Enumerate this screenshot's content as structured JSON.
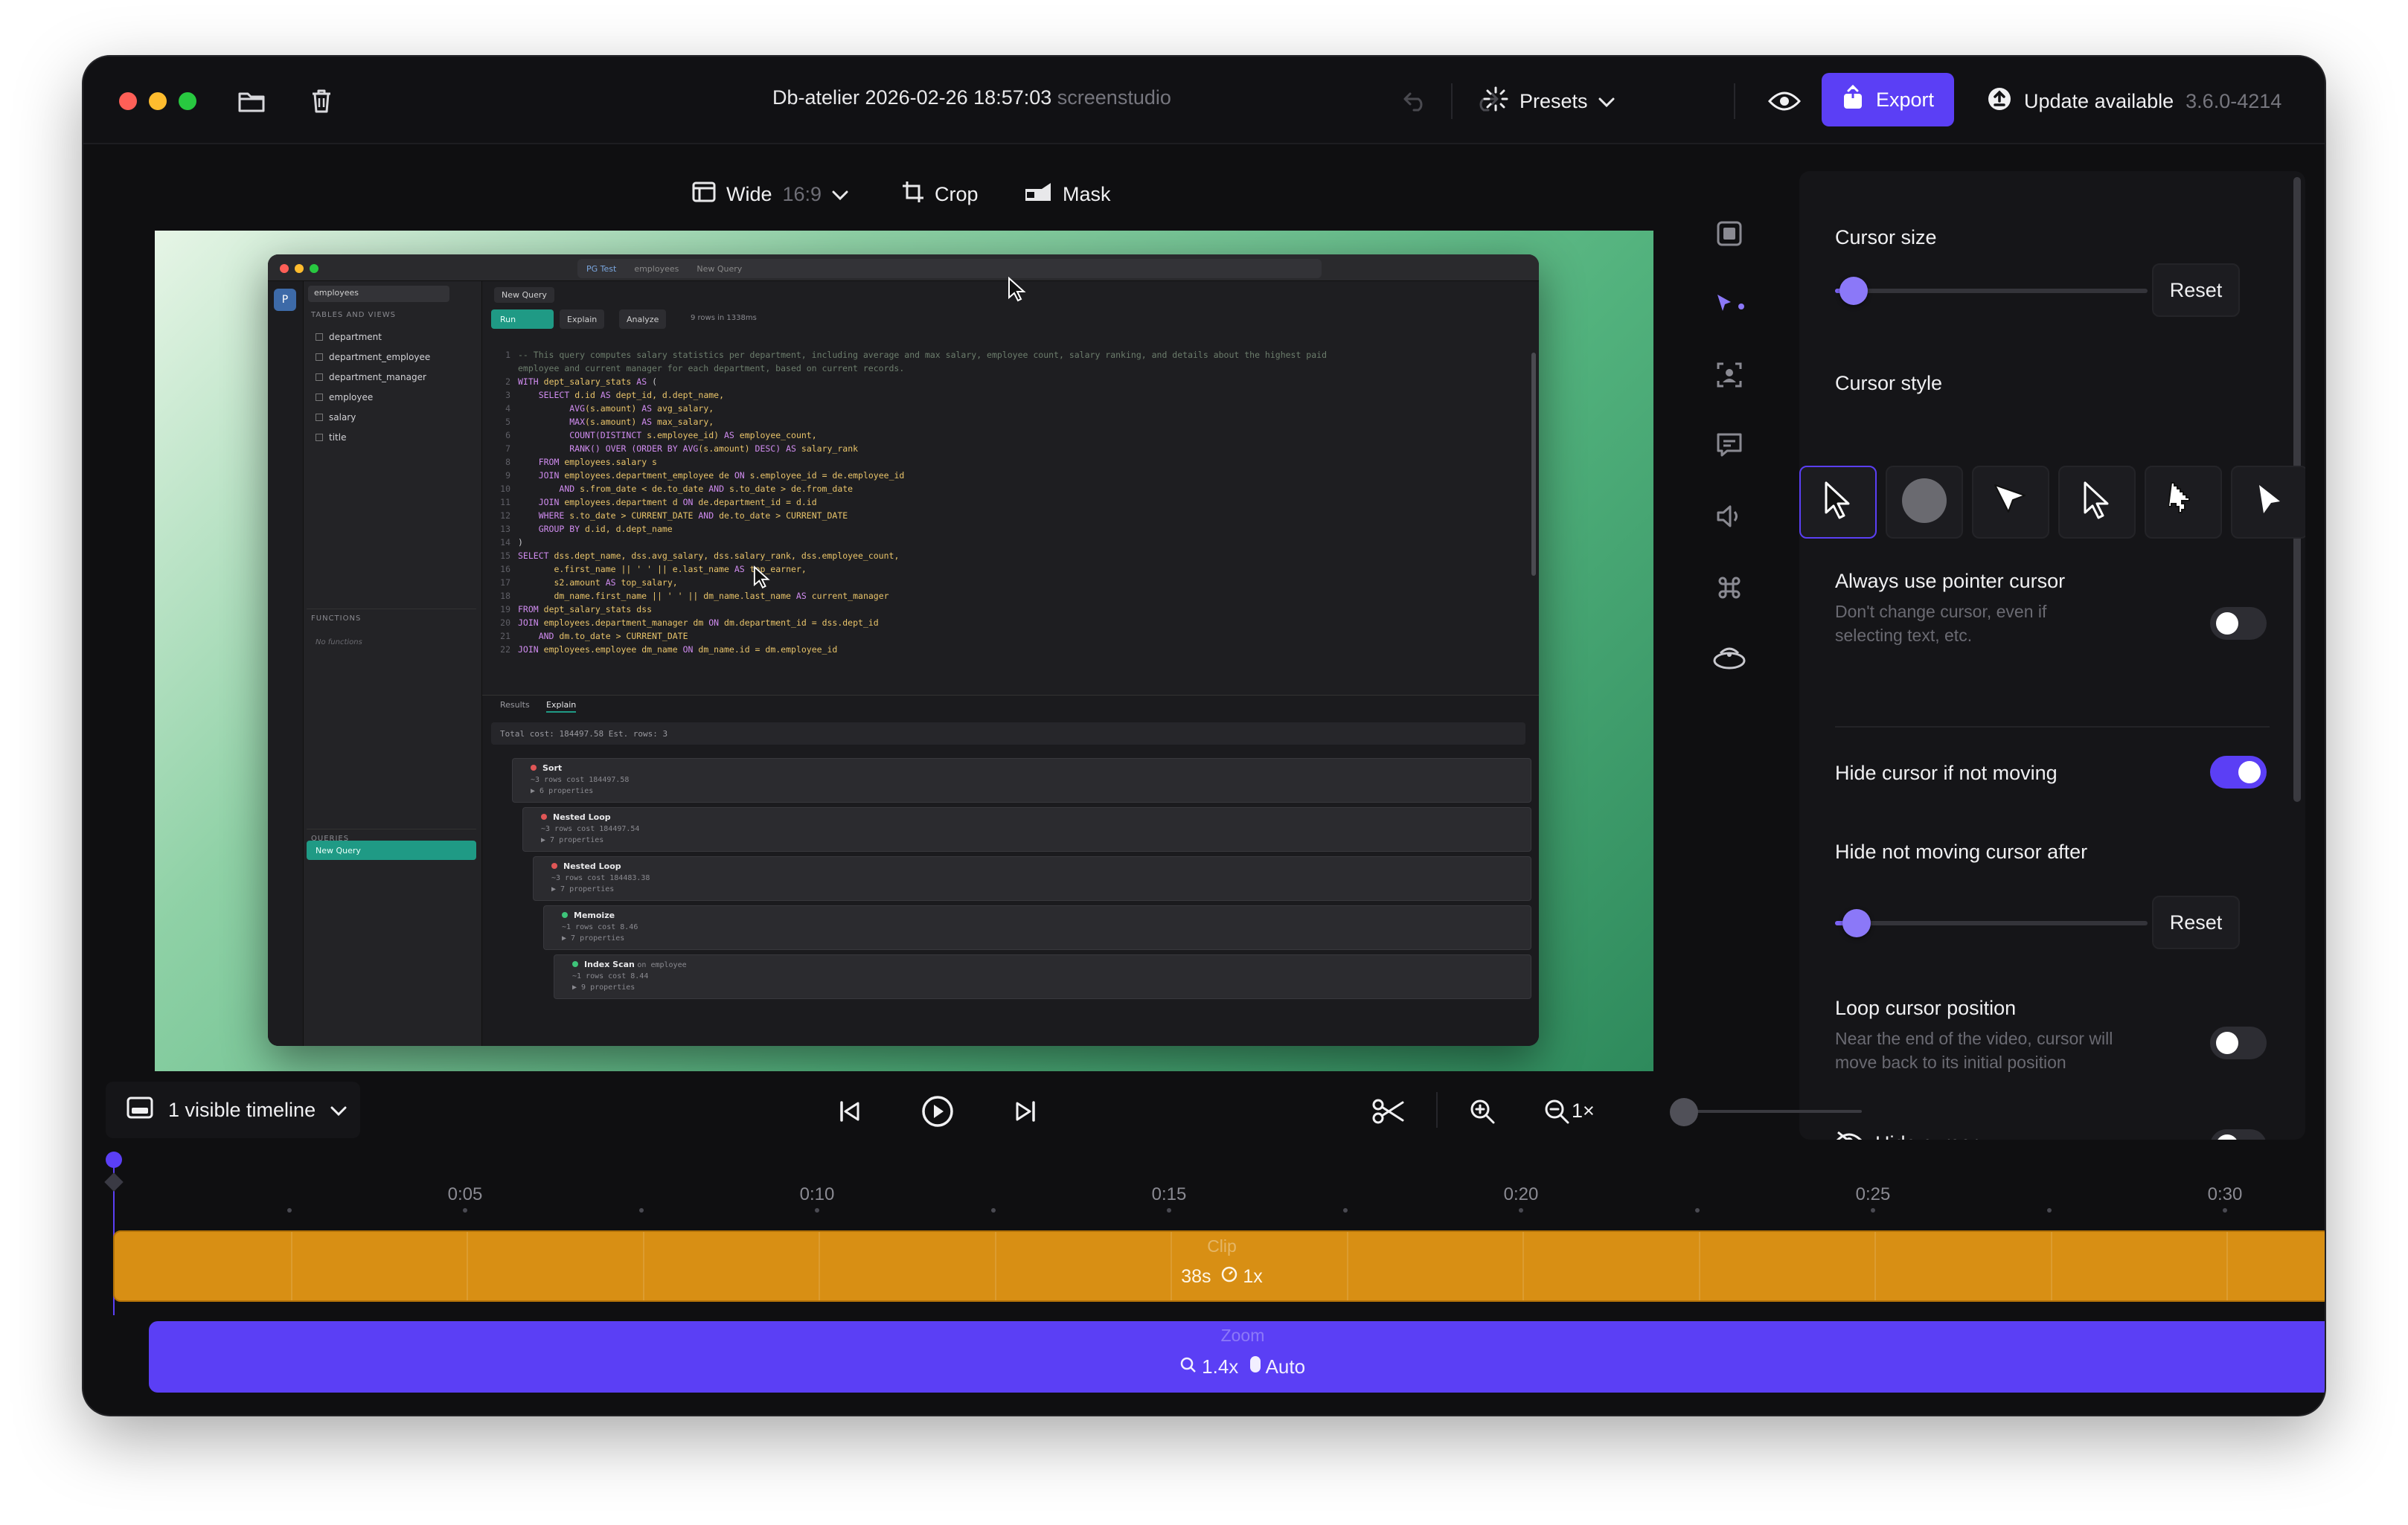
{
  "window": {
    "title": "Db-atelier 2026-02-26 18:57:03",
    "title_suffix": "screenstudio",
    "presets_label": "Presets",
    "export_label": "Export",
    "update_label": "Update available",
    "update_version": "3.6.0-4214"
  },
  "canvas_toolbar": {
    "aspect_label": "Wide",
    "aspect_ratio": "16:9",
    "crop_label": "Crop",
    "mask_label": "Mask"
  },
  "recording": {
    "tab_connection": "PG Test",
    "tab_schema": "employees",
    "tab_query": "New Query",
    "schema_select": "employees",
    "tables_header": "TABLES AND VIEWS",
    "tables": [
      "department",
      "department_employee",
      "department_manager",
      "employee",
      "salary",
      "title"
    ],
    "functions_header": "FUNCTIONS",
    "no_functions": "No functions",
    "queries_header": "QUERIES",
    "query_item": "New Query",
    "editor_tab": "New Query",
    "run_label": "Run",
    "explain_label": "Explain",
    "analyze_label": "Analyze",
    "rows_info": "9 rows in 1338ms",
    "results_tab": "Results",
    "explain_tab": "Explain",
    "total_cost": "Total cost: 184497.58  Est. rows: 3",
    "plan_nodes": [
      {
        "name": "Sort",
        "detail": "~3 rows  cost 184497.58",
        "props": "▶ 6 properties"
      },
      {
        "name": "Nested Loop",
        "detail": "~3 rows  cost 184497.54",
        "props": "▶ 7 properties"
      },
      {
        "name": "Nested Loop",
        "detail": "~3 rows  cost 184483.38",
        "props": "▶ 7 properties"
      },
      {
        "name": "Memoize",
        "detail": "~1 rows  cost 8.46",
        "props": "▶ 7 properties"
      },
      {
        "name": "Index Scan",
        "detail": "~1 rows  cost 8.44",
        "props": "▶ 9 properties",
        "suffix": "on employee"
      }
    ]
  },
  "settings": {
    "cursor_size_label": "Cursor size",
    "cursor_size_value": 0.06,
    "reset_label": "Reset",
    "cursor_style_label": "Cursor style",
    "cursor_styles": [
      "macos-arrow-icon",
      "circle-icon",
      "white-arrow-icon",
      "outline-arrow-icon",
      "pixel-arrow-icon",
      "filled-arrow-icon"
    ],
    "always_pointer_label": "Always use pointer cursor",
    "always_pointer_desc": "Don't change cursor, even if selecting text, etc.",
    "always_pointer_on": false,
    "hide_not_moving_label": "Hide cursor if not moving",
    "hide_not_moving_on": true,
    "hide_after_label": "Hide not moving cursor after",
    "hide_after_value": 0.07,
    "loop_label": "Loop cursor position",
    "loop_desc": "Near the end of the video, cursor will move back to its initial position",
    "loop_on": false,
    "hide_cursor_label": "Hide cursor",
    "hide_cursor_on": false
  },
  "controls": {
    "timeline_select": "1 visible timeline",
    "speed_label": "1×"
  },
  "timeline": {
    "ticks": [
      "0:05",
      "0:10",
      "0:15",
      "0:20",
      "0:25",
      "0:30"
    ],
    "clip_title": "Clip",
    "clip_duration": "38s",
    "clip_speed": "1x",
    "zoom_title": "Zoom",
    "zoom_level": "1.4x",
    "zoom_mode": "Auto"
  },
  "colors": {
    "accent": "#5b3ff5",
    "clip": "#d88f14",
    "background": "#0f0f11"
  }
}
